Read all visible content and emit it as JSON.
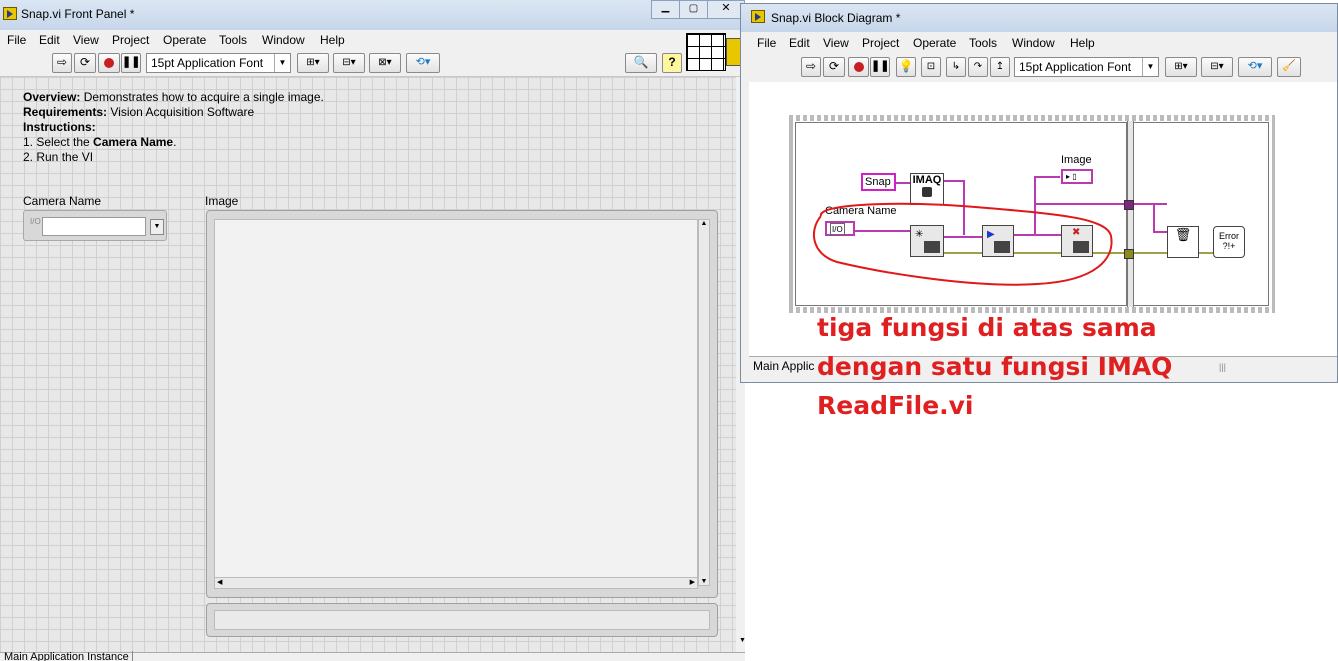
{
  "front_panel": {
    "title": "Snap.vi Front Panel *",
    "menu": [
      "File",
      "Edit",
      "View",
      "Project",
      "Operate",
      "Tools",
      "Window",
      "Help"
    ],
    "font_selector": "15pt Application Font",
    "overview_label": "Overview:",
    "overview_text": " Demonstrates how to acquire a single image.",
    "requirements_label": "Requirements:",
    "requirements_text": " Vision Acquisition Software",
    "instructions_label": "Instructions:",
    "step1_prefix": "1. Select the ",
    "step1_bold": "Camera Name",
    "step1_suffix": ".",
    "step2": "2. Run the VI",
    "camera_label": "Camera Name",
    "io_prefix": "I/O",
    "image_label": "Image",
    "status_text": "Main Application Instance"
  },
  "block_diagram": {
    "title": "Snap.vi Block Diagram *",
    "menu": [
      "File",
      "Edit",
      "View",
      "Project",
      "Operate",
      "Tools",
      "Window",
      "Help"
    ],
    "font_selector": "15pt Application Font",
    "snap_constant": "Snap",
    "imaq_label": "IMAQ",
    "camera_label": "Camera Name",
    "io_tag": "I/O",
    "image_label": "Image",
    "error_label": "Error ?!+",
    "status_text": "Main Applic"
  },
  "annotation": {
    "line1": "tiga fungsi di atas sama",
    "line2": "dengan satu fungsi IMAQ",
    "line3": "ReadFile.vi",
    "color": "#e02020"
  }
}
